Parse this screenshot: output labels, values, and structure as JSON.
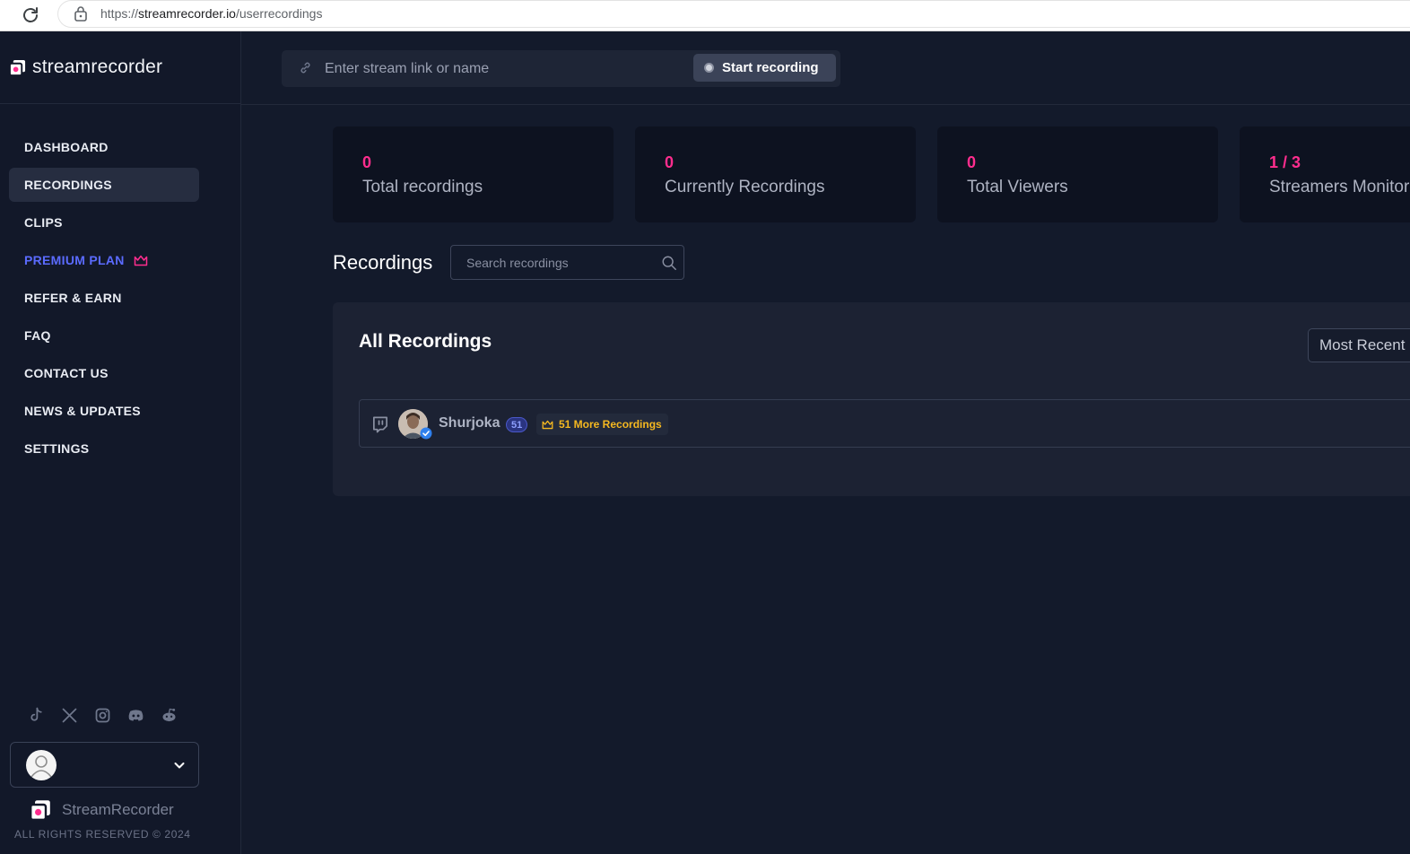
{
  "browser": {
    "url_scheme": "https://",
    "url_host": "streamrecorder.io",
    "url_path": "/userrecordings"
  },
  "brand": {
    "name": "streamrecorder",
    "footer_name": "StreamRecorder",
    "copyright": "ALL RIGHTS RESERVED © 2024"
  },
  "nav": {
    "items": [
      {
        "label": "DASHBOARD"
      },
      {
        "label": "RECORDINGS"
      },
      {
        "label": "CLIPS"
      },
      {
        "label": "PREMIUM PLAN"
      },
      {
        "label": "REFER & EARN"
      },
      {
        "label": "FAQ"
      },
      {
        "label": "CONTACT US"
      },
      {
        "label": "NEWS & UPDATES"
      },
      {
        "label": "SETTINGS"
      }
    ],
    "active": "RECORDINGS"
  },
  "socials": [
    "tiktok-icon",
    "x-icon",
    "instagram-icon",
    "discord-icon",
    "reddit-icon"
  ],
  "topbar": {
    "stream_placeholder": "Enter stream link or name",
    "start_label": "Start recording"
  },
  "stats": [
    {
      "value": "0",
      "label": "Total recordings"
    },
    {
      "value": "0",
      "label": "Currently Recordings"
    },
    {
      "value": "0",
      "label": "Total Viewers"
    },
    {
      "value": "1 / 3",
      "label": "Streamers Monitored"
    }
  ],
  "recordings": {
    "title": "Recordings",
    "search_placeholder": "Search recordings",
    "panel_title": "All Recordings",
    "sort_value": "Most Recent",
    "rows": [
      {
        "streamer": "Shurjoka",
        "count": "51",
        "more_label": "51 More Recordings",
        "platform_icon": "twitch-icon"
      }
    ]
  },
  "colors": {
    "accent_pink": "#ff2d8e",
    "premium_blue": "#5b6bff",
    "gold": "#f5b820",
    "background": "#131a2b"
  }
}
